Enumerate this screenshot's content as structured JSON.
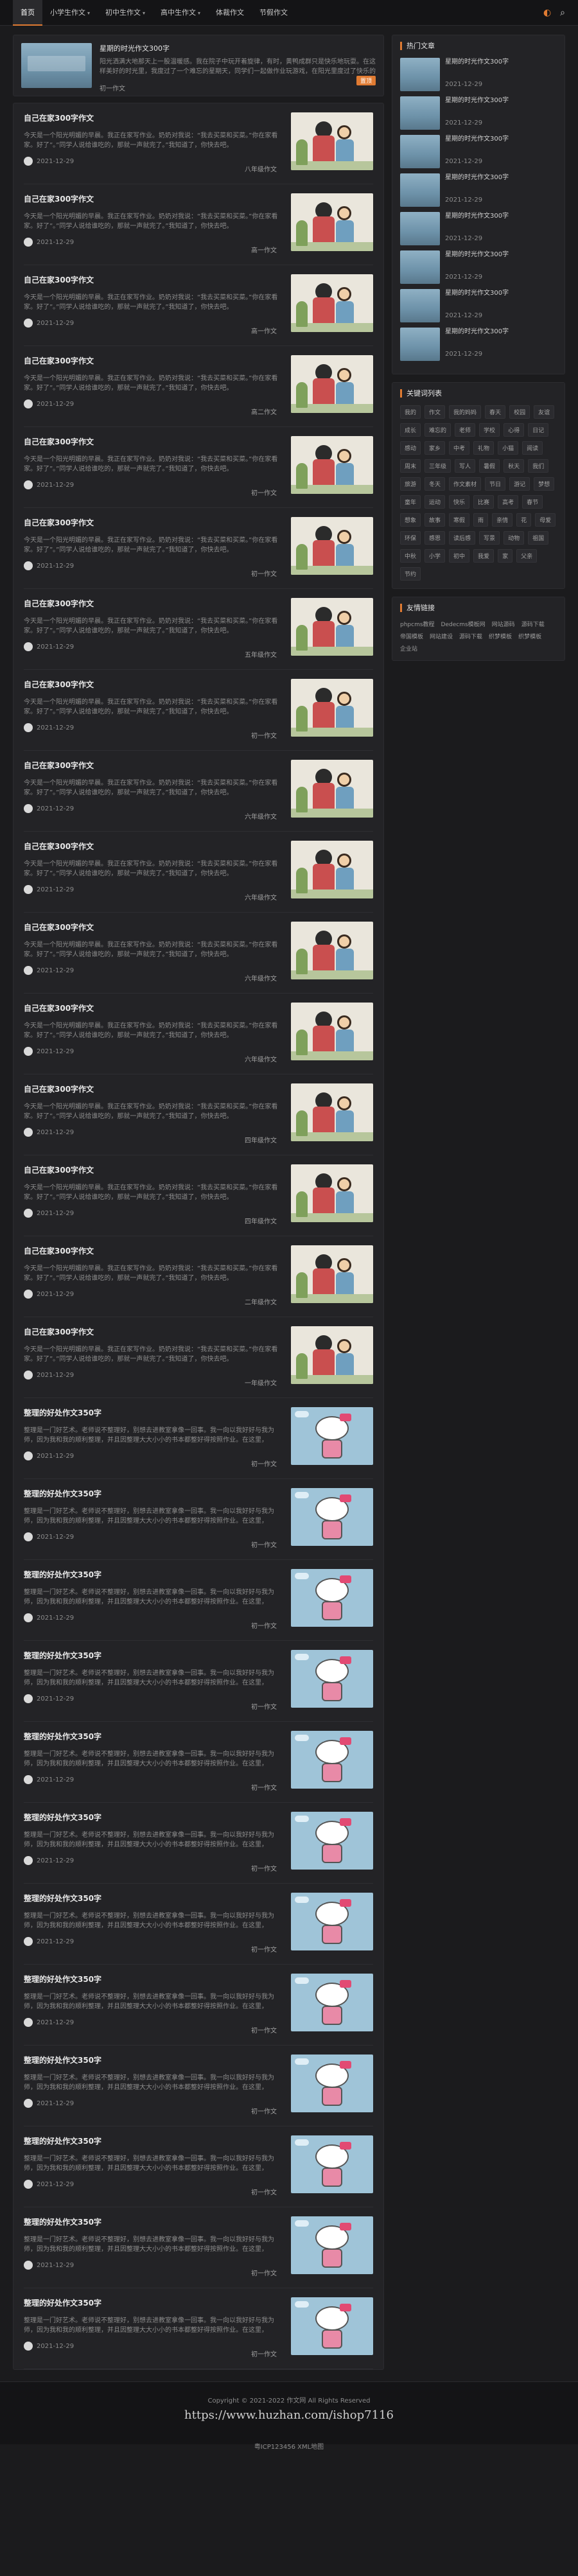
{
  "nav": {
    "items": [
      {
        "label": "首页",
        "active": true,
        "caret": false
      },
      {
        "label": "小学生作文",
        "active": false,
        "caret": true
      },
      {
        "label": "初中生作文",
        "active": false,
        "caret": true
      },
      {
        "label": "高中生作文",
        "active": false,
        "caret": true
      },
      {
        "label": "体裁作文",
        "active": false,
        "caret": false
      },
      {
        "label": "节假作文",
        "active": false,
        "caret": false
      }
    ],
    "theme_icon": "moon-icon",
    "search_icon": "search-icon"
  },
  "featured": {
    "title": "星期的时光作文300字",
    "desc": "阳光洒满大地那天上一股温暖感。我在院子中玩开着旋律，有时，黄鸭成群只是快乐地玩耍。在这样美好的时光里，我度过了一个难忘的星期天，同学们一起做作业玩游戏，在阳光里度过了快乐的时光。",
    "meta": "初一作文",
    "tag": "置顶"
  },
  "posts": [
    {
      "title": "自己在家300字作文",
      "desc": "今天是一个阳光明媚的早晨。我正在家写作业。奶奶对我说：“我去买菜和买菜。”你在家看家。好了”。”同学人说给谁吃的，那就一声就完了。”我知道了，你快去吧。",
      "date": "2021-12-29",
      "cat": "八年级作文",
      "thumb": "comic"
    },
    {
      "title": "自己在家300字作文",
      "desc": "今天是一个阳光明媚的早晨。我正在家写作业。奶奶对我说：“我去买菜和买菜。”你在家看家。好了”。”同学人说给谁吃的，那就一声就完了。”我知道了，你快去吧。",
      "date": "2021-12-29",
      "cat": "高一作文",
      "thumb": "comic"
    },
    {
      "title": "自己在家300字作文",
      "desc": "今天是一个阳光明媚的早晨。我正在家写作业。奶奶对我说：“我去买菜和买菜。”你在家看家。好了”。”同学人说给谁吃的，那就一声就完了。”我知道了，你快去吧。",
      "date": "2021-12-29",
      "cat": "高一作文",
      "thumb": "comic"
    },
    {
      "title": "自己在家300字作文",
      "desc": "今天是一个阳光明媚的早晨。我正在家写作业。奶奶对我说：“我去买菜和买菜。”你在家看家。好了”。”同学人说给谁吃的，那就一声就完了。”我知道了，你快去吧。",
      "date": "2021-12-29",
      "cat": "高二作文",
      "thumb": "comic"
    },
    {
      "title": "自己在家300字作文",
      "desc": "今天是一个阳光明媚的早晨。我正在家写作业。奶奶对我说：“我去买菜和买菜。”你在家看家。好了”。”同学人说给谁吃的，那就一声就完了。”我知道了，你快去吧。",
      "date": "2021-12-29",
      "cat": "初一作文",
      "thumb": "comic"
    },
    {
      "title": "自己在家300字作文",
      "desc": "今天是一个阳光明媚的早晨。我正在家写作业。奶奶对我说：“我去买菜和买菜。”你在家看家。好了”。”同学人说给谁吃的，那就一声就完了。”我知道了，你快去吧。",
      "date": "2021-12-29",
      "cat": "初一作文",
      "thumb": "comic"
    },
    {
      "title": "自己在家300字作文",
      "desc": "今天是一个阳光明媚的早晨。我正在家写作业。奶奶对我说：“我去买菜和买菜。”你在家看家。好了”。”同学人说给谁吃的，那就一声就完了。”我知道了，你快去吧。",
      "date": "2021-12-29",
      "cat": "五年级作文",
      "thumb": "comic"
    },
    {
      "title": "自己在家300字作文",
      "desc": "今天是一个阳光明媚的早晨。我正在家写作业。奶奶对我说：“我去买菜和买菜。”你在家看家。好了”。”同学人说给谁吃的，那就一声就完了。”我知道了，你快去吧。",
      "date": "2021-12-29",
      "cat": "初一作文",
      "thumb": "comic"
    },
    {
      "title": "自己在家300字作文",
      "desc": "今天是一个阳光明媚的早晨。我正在家写作业。奶奶对我说：“我去买菜和买菜。”你在家看家。好了”。”同学人说给谁吃的，那就一声就完了。”我知道了，你快去吧。",
      "date": "2021-12-29",
      "cat": "六年级作文",
      "thumb": "comic"
    },
    {
      "title": "自己在家300字作文",
      "desc": "今天是一个阳光明媚的早晨。我正在家写作业。奶奶对我说：“我去买菜和买菜。”你在家看家。好了”。”同学人说给谁吃的，那就一声就完了。”我知道了，你快去吧。",
      "date": "2021-12-29",
      "cat": "六年级作文",
      "thumb": "comic"
    },
    {
      "title": "自己在家300字作文",
      "desc": "今天是一个阳光明媚的早晨。我正在家写作业。奶奶对我说：“我去买菜和买菜。”你在家看家。好了”。”同学人说给谁吃的，那就一声就完了。”我知道了，你快去吧。",
      "date": "2021-12-29",
      "cat": "六年级作文",
      "thumb": "comic"
    },
    {
      "title": "自己在家300字作文",
      "desc": "今天是一个阳光明媚的早晨。我正在家写作业。奶奶对我说：“我去买菜和买菜。”你在家看家。好了”。”同学人说给谁吃的，那就一声就完了。”我知道了，你快去吧。",
      "date": "2021-12-29",
      "cat": "六年级作文",
      "thumb": "comic"
    },
    {
      "title": "自己在家300字作文",
      "desc": "今天是一个阳光明媚的早晨。我正在家写作业。奶奶对我说：“我去买菜和买菜。”你在家看家。好了”。”同学人说给谁吃的，那就一声就完了。”我知道了，你快去吧。",
      "date": "2021-12-29",
      "cat": "四年级作文",
      "thumb": "comic"
    },
    {
      "title": "自己在家300字作文",
      "desc": "今天是一个阳光明媚的早晨。我正在家写作业。奶奶对我说：“我去买菜和买菜。”你在家看家。好了”。”同学人说给谁吃的，那就一声就完了。”我知道了，你快去吧。",
      "date": "2021-12-29",
      "cat": "四年级作文",
      "thumb": "comic"
    },
    {
      "title": "自己在家300字作文",
      "desc": "今天是一个阳光明媚的早晨。我正在家写作业。奶奶对我说：“我去买菜和买菜。”你在家看家。好了”。”同学人说给谁吃的，那就一声就完了。”我知道了，你快去吧。",
      "date": "2021-12-29",
      "cat": "二年级作文",
      "thumb": "comic"
    },
    {
      "title": "自己在家300字作文",
      "desc": "今天是一个阳光明媚的早晨。我正在家写作业。奶奶对我说：“我去买菜和买菜。”你在家看家。好了”。”同学人说给谁吃的，那就一声就完了。”我知道了，你快去吧。",
      "date": "2021-12-29",
      "cat": "一年级作文",
      "thumb": "comic"
    },
    {
      "title": "整理的好处作文350字",
      "desc": "整理是一门好艺术。老师说不整理好，别想去进教室拿像一回事。我一向以我好好与我为师，因为我和我的顺利整理，并且因整理大大小小的书本都整好得按照作业。在这里，",
      "date": "2021-12-29",
      "cat": "初一作文",
      "thumb": "kitty"
    },
    {
      "title": "整理的好处作文350字",
      "desc": "整理是一门好艺术。老师说不整理好，别想去进教室拿像一回事。我一向以我好好与我为师，因为我和我的顺利整理，并且因整理大大小小的书本都整好得按照作业。在这里，",
      "date": "2021-12-29",
      "cat": "初一作文",
      "thumb": "kitty"
    },
    {
      "title": "整理的好处作文350字",
      "desc": "整理是一门好艺术。老师说不整理好，别想去进教室拿像一回事。我一向以我好好与我为师，因为我和我的顺利整理，并且因整理大大小小的书本都整好得按照作业。在这里，",
      "date": "2021-12-29",
      "cat": "初一作文",
      "thumb": "kitty"
    },
    {
      "title": "整理的好处作文350字",
      "desc": "整理是一门好艺术。老师说不整理好，别想去进教室拿像一回事。我一向以我好好与我为师，因为我和我的顺利整理，并且因整理大大小小的书本都整好得按照作业。在这里，",
      "date": "2021-12-29",
      "cat": "初一作文",
      "thumb": "kitty"
    },
    {
      "title": "整理的好处作文350字",
      "desc": "整理是一门好艺术。老师说不整理好，别想去进教室拿像一回事。我一向以我好好与我为师，因为我和我的顺利整理，并且因整理大大小小的书本都整好得按照作业。在这里，",
      "date": "2021-12-29",
      "cat": "初一作文",
      "thumb": "kitty"
    },
    {
      "title": "整理的好处作文350字",
      "desc": "整理是一门好艺术。老师说不整理好，别想去进教室拿像一回事。我一向以我好好与我为师，因为我和我的顺利整理，并且因整理大大小小的书本都整好得按照作业。在这里，",
      "date": "2021-12-29",
      "cat": "初一作文",
      "thumb": "kitty"
    },
    {
      "title": "整理的好处作文350字",
      "desc": "整理是一门好艺术。老师说不整理好，别想去进教室拿像一回事。我一向以我好好与我为师，因为我和我的顺利整理，并且因整理大大小小的书本都整好得按照作业。在这里，",
      "date": "2021-12-29",
      "cat": "初一作文",
      "thumb": "kitty"
    },
    {
      "title": "整理的好处作文350字",
      "desc": "整理是一门好艺术。老师说不整理好，别想去进教室拿像一回事。我一向以我好好与我为师，因为我和我的顺利整理，并且因整理大大小小的书本都整好得按照作业。在这里，",
      "date": "2021-12-29",
      "cat": "初一作文",
      "thumb": "kitty"
    },
    {
      "title": "整理的好处作文350字",
      "desc": "整理是一门好艺术。老师说不整理好，别想去进教室拿像一回事。我一向以我好好与我为师，因为我和我的顺利整理，并且因整理大大小小的书本都整好得按照作业。在这里，",
      "date": "2021-12-29",
      "cat": "初一作文",
      "thumb": "kitty"
    },
    {
      "title": "整理的好处作文350字",
      "desc": "整理是一门好艺术。老师说不整理好，别想去进教室拿像一回事。我一向以我好好与我为师，因为我和我的顺利整理，并且因整理大大小小的书本都整好得按照作业。在这里，",
      "date": "2021-12-29",
      "cat": "初一作文",
      "thumb": "kitty"
    },
    {
      "title": "整理的好处作文350字",
      "desc": "整理是一门好艺术。老师说不整理好，别想去进教室拿像一回事。我一向以我好好与我为师，因为我和我的顺利整理，并且因整理大大小小的书本都整好得按照作业。在这里，",
      "date": "2021-12-29",
      "cat": "初一作文",
      "thumb": "kitty"
    },
    {
      "title": "整理的好处作文350字",
      "desc": "整理是一门好艺术。老师说不整理好，别想去进教室拿像一回事。我一向以我好好与我为师，因为我和我的顺利整理，并且因整理大大小小的书本都整好得按照作业。在这里，",
      "date": "2021-12-29",
      "cat": "初一作文",
      "thumb": "kitty"
    }
  ],
  "sidebar": {
    "hot_title": "热门文章",
    "hot": [
      {
        "title": "星期的时光作文300字",
        "date": "2021-12-29"
      },
      {
        "title": "星期的时光作文300字",
        "date": "2021-12-29"
      },
      {
        "title": "星期的时光作文300字",
        "date": "2021-12-29"
      },
      {
        "title": "星期的时光作文300字",
        "date": "2021-12-29"
      },
      {
        "title": "星期的时光作文300字",
        "date": "2021-12-29"
      },
      {
        "title": "星期的时光作文300字",
        "date": "2021-12-29"
      },
      {
        "title": "星期的时光作文300字",
        "date": "2021-12-29"
      },
      {
        "title": "星期的时光作文300字",
        "date": "2021-12-29"
      }
    ],
    "tags_title": "关键词列表",
    "tags": [
      "我的",
      "作文",
      "我的妈妈",
      "春天",
      "校园",
      "友谊",
      "成长",
      "难忘的",
      "老师",
      "学校",
      "心得",
      "日记",
      "感动",
      "家乡",
      "中考",
      "礼物",
      "小猫",
      "阅读",
      "周末",
      "三年级",
      "写人",
      "暑假",
      "秋天",
      "我们",
      "旅游",
      "冬天",
      "作文素材",
      "节日",
      "游记",
      "梦想",
      "童年",
      "运动",
      "快乐",
      "比赛",
      "高考",
      "春节",
      "想象",
      "故事",
      "寒假",
      "雨",
      "亲情",
      "花",
      "母爱",
      "环保",
      "感恩",
      "读后感",
      "写景",
      "动物",
      "祖国",
      "中秋",
      "小学",
      "初中",
      "我爱",
      "家",
      "父亲",
      "节约"
    ],
    "links_title": "友情链接",
    "links": [
      "phpcms教程",
      "Dedecms模板网",
      "网站源码",
      "源码下载",
      "帝国模板",
      "网站建设",
      "源码下载",
      "织梦模板",
      "织梦模板",
      "企业站"
    ]
  },
  "footer": {
    "copy": "Copyright © 2021-2022 作文网 All Rights Reserved",
    "icp": "粤ICP123456 XML地图",
    "watermark": "https://www.huzhan.com/ishop7116"
  }
}
